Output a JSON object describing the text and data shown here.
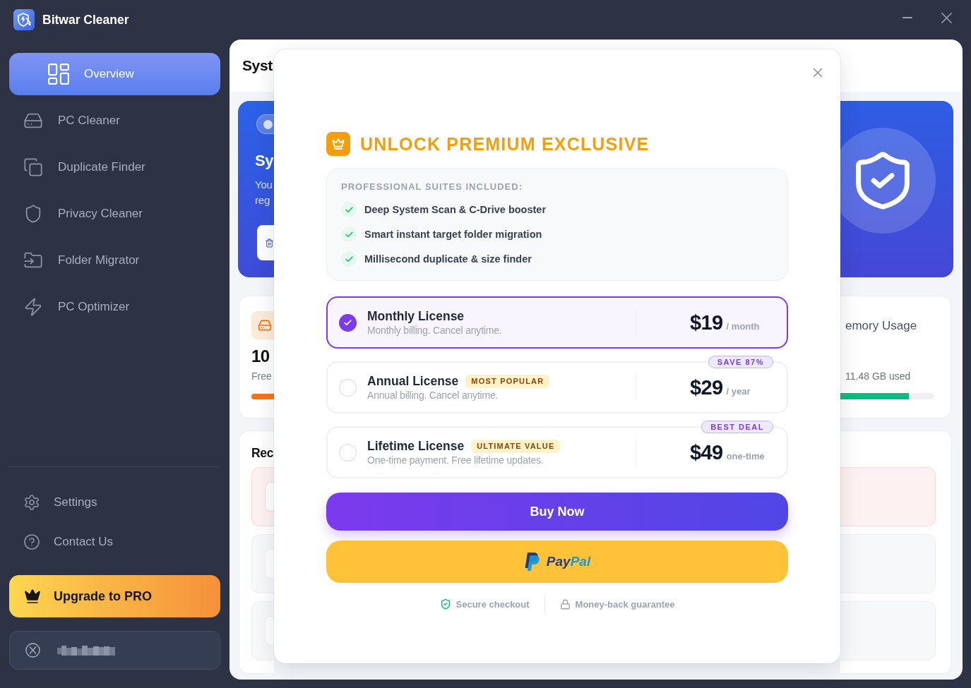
{
  "window": {
    "title": "Bitwar Cleaner"
  },
  "sidebar": {
    "nav_items": [
      {
        "label": "Overview",
        "selected": true
      },
      {
        "label": "PC Cleaner",
        "selected": false
      },
      {
        "label": "Duplicate Finder",
        "selected": false
      },
      {
        "label": "Privacy Cleaner",
        "selected": false
      },
      {
        "label": "Folder Migrator",
        "selected": false
      },
      {
        "label": "PC Optimizer",
        "selected": false
      }
    ],
    "footer_items": [
      {
        "label": "Settings"
      },
      {
        "label": "Contact Us"
      }
    ],
    "upgrade_button": {
      "label": "Upgrade to PRO"
    }
  },
  "main": {
    "title": "Syst",
    "hero_card": {
      "heading": "Sy",
      "lines": [
        "You",
        "reg"
      ]
    },
    "disk_card": {
      "value": "10",
      "caption": "Free",
      "level": 1
    },
    "memory_card": {
      "title": "emory Usage",
      "caption": "11.48 GB used",
      "level": 0.73
    },
    "recent_card": {
      "title": "Rec",
      "rows": [
        {
          "kind": "alert"
        },
        {
          "kind": "normal"
        },
        {
          "kind": "normal"
        }
      ]
    }
  },
  "modal": {
    "title": "UNLOCK PREMIUM EXCLUSIVE",
    "features": {
      "heading": "PROFESSIONAL SUITES INCLUDED:",
      "items": [
        "Deep System Scan & C-Drive booster",
        "Smart instant target folder migration",
        "Millisecond duplicate & size finder"
      ]
    },
    "plans": [
      {
        "name": "Monthly License",
        "description": "Monthly billing. Cancel anytime.",
        "price": "$19",
        "period": "/ month",
        "selected": true
      },
      {
        "name": "Annual License",
        "badge": "MOST POPULAR",
        "description": "Annual billing. Cancel anytime.",
        "price": "$29",
        "period": "/ year",
        "ribbon": "SAVE 87%",
        "selected": false
      },
      {
        "name": "Lifetime License",
        "badge": "ULTIMATE VALUE",
        "description": "One-time payment. Free lifetime updates.",
        "price": "$49",
        "period": "one-time",
        "ribbon": "BEST DEAL",
        "selected": false
      }
    ],
    "buy_button": {
      "label": "Buy Now"
    },
    "paypal_button": {
      "logo_parts": [
        "Pay",
        "Pal"
      ]
    },
    "assurances": [
      "Secure checkout",
      "Money-back guarantee"
    ]
  }
}
